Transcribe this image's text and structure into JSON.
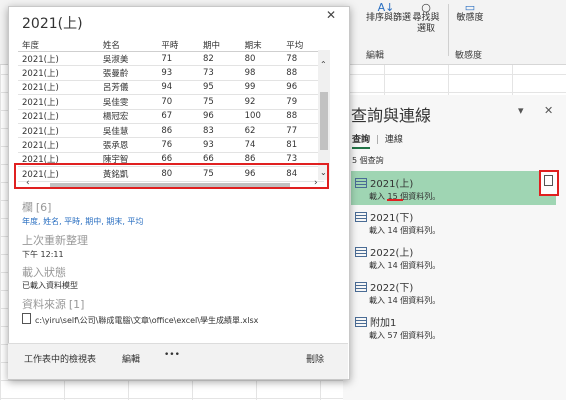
{
  "ribbon": {
    "sort_filter": "排序與篩選",
    "find_select": "尋找與\n選取",
    "sensitivity": "敏感度",
    "group_edit": "編輯",
    "group_sensitivity": "敏感度"
  },
  "pane": {
    "title": "查詢與連線",
    "tab_queries": "查詢",
    "tab_separator": "|",
    "tab_connections": "連線",
    "count": "5 個查詢",
    "queries": [
      {
        "name": "2021(上)",
        "sub": "載入 15 個資料列。"
      },
      {
        "name": "2021(下)",
        "sub": "載入 14 個資料列。"
      },
      {
        "name": "2022(上)",
        "sub": "載入 14 個資料列。"
      },
      {
        "name": "2022(下)",
        "sub": "載入 14 個資料列。"
      },
      {
        "name": "附加1",
        "sub": "載入 57 個資料列。"
      }
    ]
  },
  "card": {
    "title": "2021(上)",
    "headers": [
      "年度",
      "姓名",
      "平時",
      "期中",
      "期末",
      "平均"
    ],
    "rows": [
      [
        "2021(上)",
        "吳淑美",
        "71",
        "82",
        "80",
        "78"
      ],
      [
        "2021(上)",
        "張曼齡",
        "93",
        "73",
        "98",
        "88"
      ],
      [
        "2021(上)",
        "呂芳儀",
        "94",
        "95",
        "99",
        "96"
      ],
      [
        "2021(上)",
        "吳佳雯",
        "70",
        "75",
        "92",
        "79"
      ],
      [
        "2021(上)",
        "楊冠宏",
        "67",
        "96",
        "100",
        "88"
      ],
      [
        "2021(上)",
        "吳佳慧",
        "86",
        "83",
        "62",
        "77"
      ],
      [
        "2021(上)",
        "張承恩",
        "76",
        "93",
        "74",
        "81"
      ],
      [
        "2021(上)",
        "陳宇智",
        "66",
        "66",
        "86",
        "73"
      ],
      [
        "2021(上)",
        "黃銘凱",
        "80",
        "75",
        "96",
        "84"
      ]
    ],
    "columns_label": "欄",
    "columns_count": "[6]",
    "columns_list": "年度, 姓名, 平時, 期中, 期末, 平均",
    "last_refresh_label": "上次重新整理",
    "last_refresh_value": "下午 12:11",
    "load_status_label": "載入狀態",
    "load_status_value": "已載入資料模型",
    "source_label": "資料來源",
    "source_count": "[1]",
    "source_path": "c:\\yiru\\self\\公司\\聯成電腦\\文章\\office\\excel\\學生成績單.xlsx",
    "footer_view": "工作表中的檢視表",
    "footer_edit": "編輯",
    "footer_more": "•••",
    "footer_delete": "刪除"
  }
}
